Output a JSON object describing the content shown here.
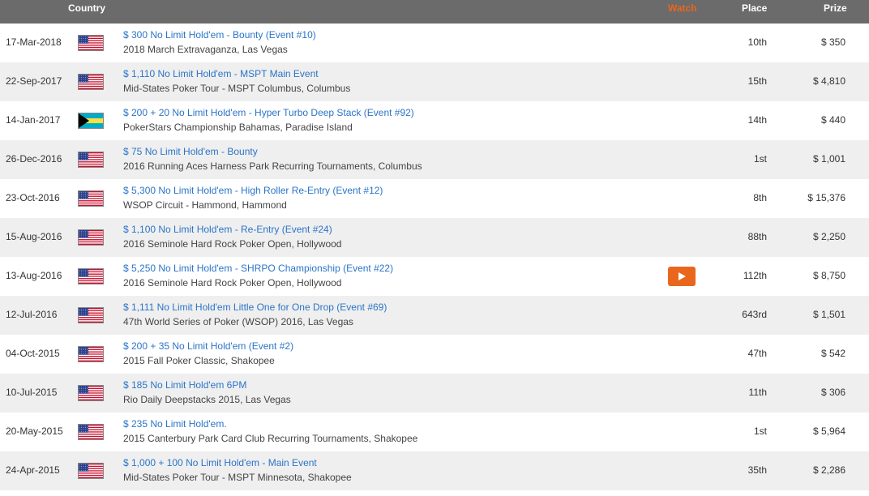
{
  "header": {
    "country": "Country",
    "watch": "Watch",
    "place": "Place",
    "prize": "Prize"
  },
  "colors": {
    "header_bg": "#6b6b6b",
    "watch_accent": "#e8671c",
    "link": "#2b74c8",
    "alt_row": "#efefef"
  },
  "rows": [
    {
      "date": "17-Mar-2018",
      "flag": "us-flag-icon",
      "event": "$ 300 No Limit Hold'em - Bounty (Event #10)",
      "series": "2018 March Extravaganza, Las Vegas",
      "place": "10th",
      "prize": "$ 350"
    },
    {
      "date": "22-Sep-2017",
      "flag": "us-flag-icon",
      "event": "$ 1,110 No Limit Hold'em - MSPT Main Event",
      "series": "Mid-States Poker Tour - MSPT Columbus, Columbus",
      "place": "15th",
      "prize": "$ 4,810"
    },
    {
      "date": "14-Jan-2017",
      "flag": "bahamas-flag-icon",
      "event": "$ 200 + 20 No Limit Hold'em - Hyper Turbo Deep Stack (Event #92)",
      "series": "PokerStars Championship Bahamas, Paradise Island",
      "place": "14th",
      "prize": "$ 440"
    },
    {
      "date": "26-Dec-2016",
      "flag": "us-flag-icon",
      "event": "$ 75 No Limit Hold'em - Bounty",
      "series": "2016 Running Aces Harness Park Recurring Tournaments, Columbus",
      "place": "1st",
      "prize": "$ 1,001"
    },
    {
      "date": "23-Oct-2016",
      "flag": "us-flag-icon",
      "event": "$ 5,300 No Limit Hold'em - High Roller Re-Entry (Event #12)",
      "series": "WSOP Circuit - Hammond, Hammond",
      "place": "8th",
      "prize": "$ 15,376"
    },
    {
      "date": "15-Aug-2016",
      "flag": "us-flag-icon",
      "event": "$ 1,100 No Limit Hold'em - Re-Entry (Event #24)",
      "series": "2016 Seminole Hard Rock Poker Open, Hollywood",
      "place": "88th",
      "prize": "$ 2,250"
    },
    {
      "date": "13-Aug-2016",
      "flag": "us-flag-icon",
      "event": "$ 5,250 No Limit Hold'em - SHRPO Championship (Event #22)",
      "series": "2016 Seminole Hard Rock Poker Open, Hollywood",
      "place": "112th",
      "prize": "$ 8,750",
      "watch": true
    },
    {
      "date": "12-Jul-2016",
      "flag": "us-flag-icon",
      "event": "$ 1,111 No Limit Hold'em Little One for One Drop (Event #69)",
      "series": "47th World Series of Poker (WSOP) 2016, Las Vegas",
      "place": "643rd",
      "prize": "$ 1,501"
    },
    {
      "date": "04-Oct-2015",
      "flag": "us-flag-icon",
      "event": "$ 200 + 35 No Limit Hold'em (Event #2)",
      "series": "2015 Fall Poker Classic, Shakopee",
      "place": "47th",
      "prize": "$ 542"
    },
    {
      "date": "10-Jul-2015",
      "flag": "us-flag-icon",
      "event": "$ 185 No Limit Hold'em 6PM",
      "series": "Rio Daily Deepstacks 2015, Las Vegas",
      "place": "11th",
      "prize": "$ 306"
    },
    {
      "date": "20-May-2015",
      "flag": "us-flag-icon",
      "event": "$ 235 No Limit Hold'em.",
      "series": "2015 Canterbury Park Card Club Recurring Tournaments, Shakopee",
      "place": "1st",
      "prize": "$ 5,964"
    },
    {
      "date": "24-Apr-2015",
      "flag": "us-flag-icon",
      "event": "$ 1,000 + 100 No Limit Hold'em - Main Event",
      "series": "Mid-States Poker Tour - MSPT Minnesota, Shakopee",
      "place": "35th",
      "prize": "$ 2,286"
    }
  ]
}
